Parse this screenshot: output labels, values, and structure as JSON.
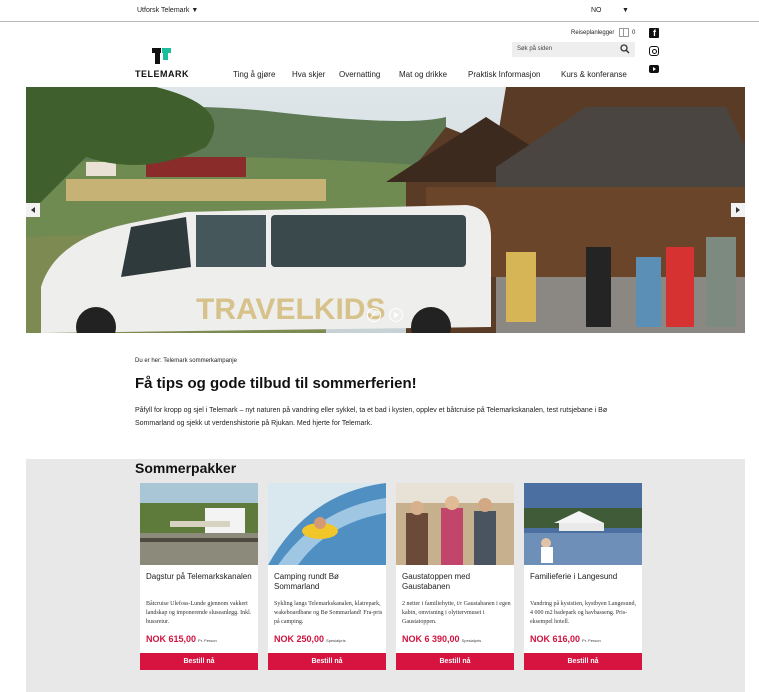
{
  "topbar": {
    "explore": "Utforsk Telemark ▼",
    "language": "NO",
    "language_caret": "▼"
  },
  "header": {
    "trip_planner": "Reiseplanlegger",
    "trip_count": "0",
    "search_placeholder": "Søk på siden",
    "logo": "TELEMARK",
    "brand_color": "#1bbf9c",
    "social": [
      "facebook-icon",
      "instagram-icon",
      "youtube-icon"
    ]
  },
  "nav": {
    "items": [
      "Ting å gjøre",
      "Hva skjer",
      "Overnatting",
      "Mat og drikke",
      "Praktisk Informasjon",
      "Kurs & konferanse"
    ]
  },
  "hero": {
    "van_text": "TRAVELKIDS",
    "controls": [
      "mute-icon",
      "play-icon"
    ]
  },
  "breadcrumb": "Du er her: Telemark sommerkampanje",
  "intro": {
    "title": "Få tips og gode tilbud til sommerferien!",
    "body": "Påfyll for kropp og sjel i Telemark – nyt naturen på vandring eller sykkel, ta et bad i kysten, opplev et båtcruise på Telemarkskanalen, test rutsjebane i Bø Sommarland og sjekk ut verdensh­istorie på Rjukan. Med hjerte for Telemark."
  },
  "packages": {
    "title": "Sommerpakker",
    "accent": "#d7143f",
    "cards": [
      {
        "title": "Dagstur på Telemarkskanalen",
        "description": "Båtcruise Ulefoss-Lunde gjennom vakkert landskap og imponerende sluseanlegg. Inkl. bussretur.",
        "price": "NOK 615,00",
        "price_note": "Pr. Person",
        "button": "Bestill nå"
      },
      {
        "title": "Camping rundt Bø Sommarland",
        "description": "Sykling langs Telemarkskanalen, klatrepark, wakeboardbane og Bø Sommarland! Fra-pris på camping.",
        "price": "NOK 250,00",
        "price_note": "Spesialpris",
        "button": "Bestill nå"
      },
      {
        "title": "Gaustatoppen med Gaustabanen",
        "description": "2 netter i familiehytte, t/r Gaustabanen i egen kabin, omvisning i olyttervmuset i Gaustatoppen.",
        "price": "NOK 6 390,00",
        "price_note": "Spesialpris",
        "button": "Bestill nå"
      },
      {
        "title": "Familieferie i Langesund",
        "description": "Vandring på kyststien, kystbyen Langesund, 4 000 m2 badepark og havbasseng. Pris-eksempel hotell.",
        "price": "NOK 616,00",
        "price_note": "Pr. Person",
        "button": "Bestill nå"
      }
    ]
  }
}
